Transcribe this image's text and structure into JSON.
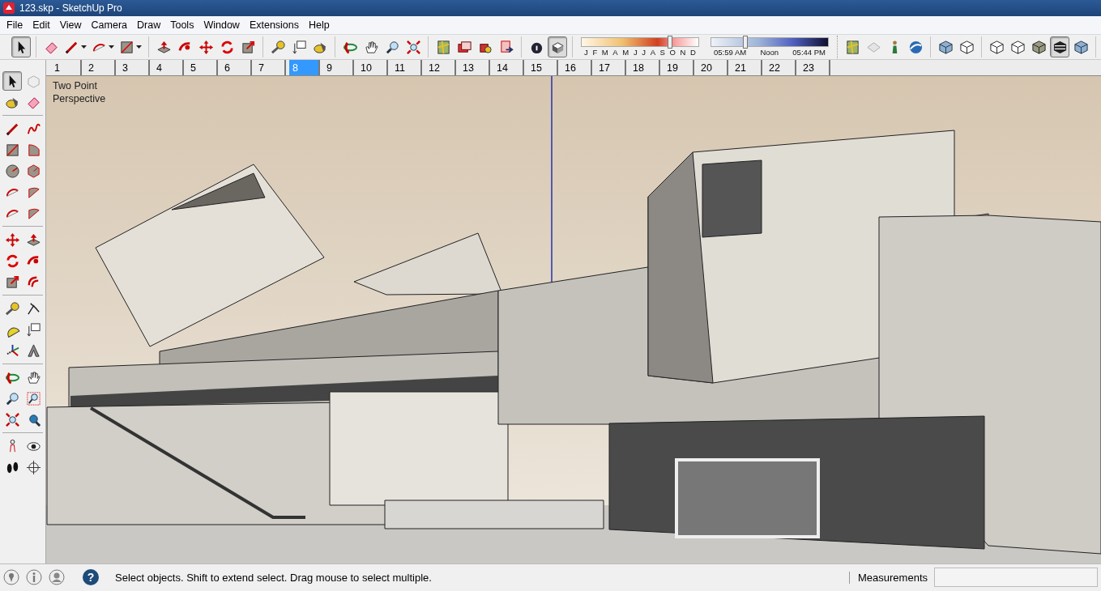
{
  "window": {
    "title": "123.skp - SketchUp Pro"
  },
  "menu_bar": [
    "File",
    "Edit",
    "View",
    "Camera",
    "Draw",
    "Tools",
    "Window",
    "Extensions",
    "Help"
  ],
  "main_toolbar": {
    "groups": [
      [
        {
          "selected": true
        }
      ],
      [
        {
          "selected": false
        },
        {
          "selected": false
        },
        {
          "selected": false
        },
        {
          "selected": false
        }
      ],
      [
        {
          "selected": false
        },
        {
          "selected": false
        },
        {
          "selected": false
        },
        {
          "selected": false
        },
        {
          "selected": false
        }
      ],
      [
        {
          "selected": false
        },
        {
          "selected": false
        },
        {
          "selected": false
        }
      ],
      [
        {
          "selected": false
        },
        {
          "selected": false
        },
        {
          "selected": false
        },
        {
          "selected": false
        }
      ],
      [
        {
          "selected": false
        },
        {
          "selected": false
        },
        {
          "selected": false
        },
        {
          "selected": false
        }
      ],
      [
        {
          "selected": false
        },
        {
          "selected": true
        }
      ]
    ]
  },
  "shadow_settings": {
    "month_slider": {
      "labels": [
        "J",
        "F",
        "M",
        "A",
        "M",
        "J",
        "J",
        "A",
        "S",
        "O",
        "N",
        "D"
      ],
      "level": 0.76
    },
    "time_slider": {
      "labels": [
        "05:59 AM",
        "Noon",
        "05:44 PM"
      ],
      "level": 0.29
    }
  },
  "view_toolbar": {
    "groups": [
      [
        {
          "selected": false
        },
        {
          "selected": false
        },
        {
          "selected": false
        },
        {
          "selected": false
        }
      ],
      [
        {
          "selected": false
        },
        {
          "selected": false
        }
      ],
      [
        {
          "selected": false
        },
        {
          "selected": false
        },
        {
          "selected": false
        },
        {
          "selected": true
        },
        {
          "selected": false
        }
      ]
    ]
  },
  "scene_tabs": [
    {
      "label": "1",
      "selected": false
    },
    {
      "label": "2",
      "selected": false
    },
    {
      "label": "3",
      "selected": false
    },
    {
      "label": "4",
      "selected": false
    },
    {
      "label": "5",
      "selected": false
    },
    {
      "label": "6",
      "selected": false
    },
    {
      "label": "7",
      "selected": false
    },
    {
      "label": "8",
      "selected": true
    },
    {
      "label": "9",
      "selected": false
    },
    {
      "label": "10",
      "selected": false
    },
    {
      "label": "11",
      "selected": false
    },
    {
      "label": "12",
      "selected": false
    },
    {
      "label": "13",
      "selected": false
    },
    {
      "label": "14",
      "selected": false
    },
    {
      "label": "15",
      "selected": false
    },
    {
      "label": "16",
      "selected": false
    },
    {
      "label": "17",
      "selected": false
    },
    {
      "label": "18",
      "selected": false
    },
    {
      "label": "19",
      "selected": false
    },
    {
      "label": "20",
      "selected": false
    },
    {
      "label": "21",
      "selected": false
    },
    {
      "label": "22",
      "selected": false
    },
    {
      "label": "23",
      "selected": false
    }
  ],
  "tools_palette": {
    "groups": [
      [
        {
          "selected": true
        },
        {
          "selected": false
        },
        {
          "selected": false
        },
        {
          "selected": false
        }
      ],
      [
        {
          "selected": false
        },
        {
          "selected": false
        },
        {
          "selected": false
        },
        {
          "selected": false
        },
        {
          "selected": false
        },
        {
          "selected": false
        },
        {
          "selected": false
        },
        {
          "selected": false
        },
        {
          "selected": false
        },
        {
          "selected": false
        }
      ],
      [
        {
          "selected": false
        },
        {
          "selected": false
        },
        {
          "selected": false
        },
        {
          "selected": false
        },
        {
          "selected": false
        },
        {
          "selected": false
        }
      ],
      [
        {
          "selected": false
        },
        {
          "selected": false
        },
        {
          "selected": false
        },
        {
          "selected": false
        },
        {
          "selected": false
        },
        {
          "selected": false
        }
      ],
      [
        {
          "selected": false
        },
        {
          "selected": false
        },
        {
          "selected": false
        },
        {
          "selected": false
        },
        {
          "selected": false
        },
        {
          "selected": false
        }
      ],
      [
        {
          "selected": false
        },
        {
          "selected": false
        },
        {
          "selected": false
        },
        {
          "selected": false
        }
      ]
    ]
  },
  "viewport": {
    "camera_label": "Two Point Perspective"
  },
  "status_bar": {
    "help_glyph": "?",
    "message": "Select objects. Shift to extend select. Drag mouse to select multiple.",
    "measurements_label": "Measurements"
  }
}
